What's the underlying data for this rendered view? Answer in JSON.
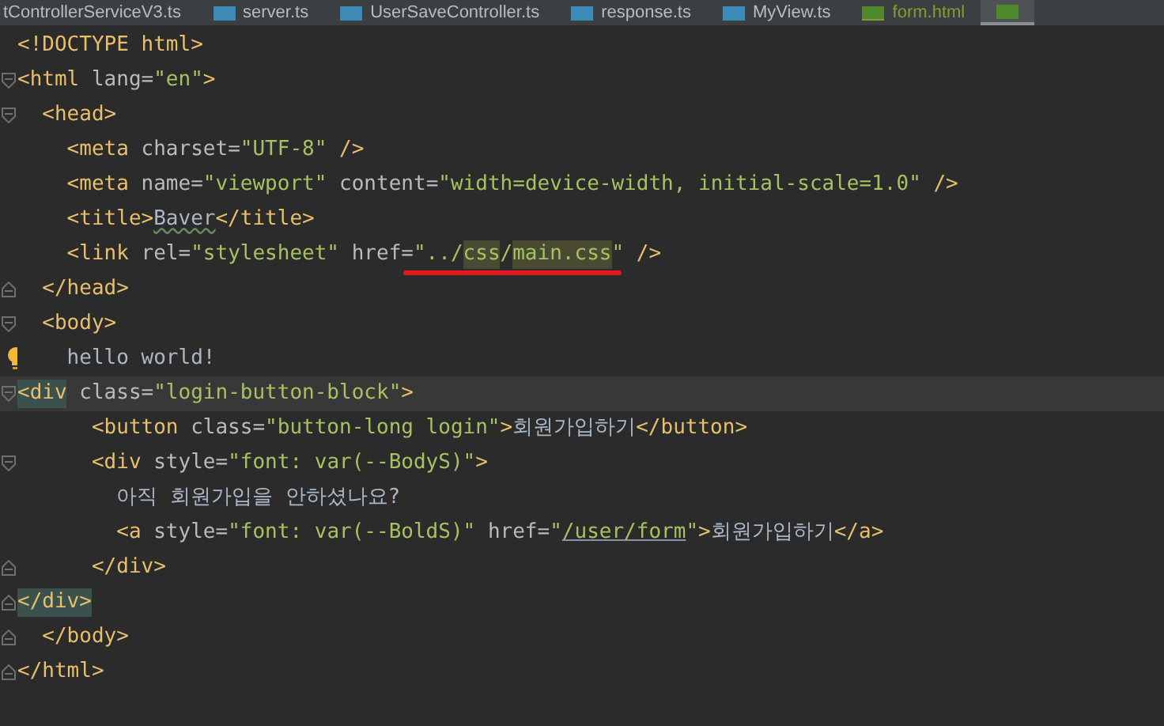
{
  "tabs": [
    {
      "kind": "ts",
      "label": "tControllerServiceV3.ts",
      "selected": false,
      "modified": false
    },
    {
      "kind": "ts",
      "label": "server.ts",
      "selected": false,
      "modified": false
    },
    {
      "kind": "ts",
      "label": "UserSaveController.ts",
      "selected": false,
      "modified": false
    },
    {
      "kind": "ts",
      "label": "response.ts",
      "selected": false,
      "modified": false
    },
    {
      "kind": "ts",
      "label": "MyView.ts",
      "selected": false,
      "modified": false
    },
    {
      "kind": "html",
      "label": "form.html",
      "selected": false,
      "modified": true
    },
    {
      "kind": "html",
      "selected": true,
      "modified": false
    }
  ],
  "editor": {
    "lines": [
      {
        "kind": "plain",
        "current": false,
        "tokens": [
          {
            "kind": "tag",
            "text": "<!DOCTYPE html>"
          }
        ]
      },
      {
        "kind": "fold-start",
        "current": false,
        "tokens": [
          {
            "kind": "tag",
            "text": "<html"
          },
          {
            "kind": "attr",
            "text": " lang"
          },
          {
            "kind": "attr",
            "text": "="
          },
          {
            "kind": "str",
            "text": "\"en\""
          },
          {
            "kind": "tag",
            "text": ">"
          }
        ]
      },
      {
        "kind": "fold-start",
        "current": false,
        "tokens": [
          {
            "kind": "tag",
            "text": "  <head>"
          }
        ]
      },
      {
        "kind": "plain",
        "current": false,
        "tokens": [
          {
            "kind": "tag",
            "text": "    <meta"
          },
          {
            "kind": "attr",
            "text": " charset"
          },
          {
            "kind": "attr",
            "text": "="
          },
          {
            "kind": "str",
            "text": "\"UTF-8\""
          },
          {
            "kind": "tag",
            "text": " />"
          }
        ]
      },
      {
        "kind": "plain",
        "current": false,
        "tokens": [
          {
            "kind": "tag",
            "text": "    <meta"
          },
          {
            "kind": "attr",
            "text": " name"
          },
          {
            "kind": "attr",
            "text": "="
          },
          {
            "kind": "str",
            "text": "\"viewport\""
          },
          {
            "kind": "attr",
            "text": " content"
          },
          {
            "kind": "attr",
            "text": "="
          },
          {
            "kind": "str",
            "text": "\"width=device-width, initial-scale=1.0\""
          },
          {
            "kind": "tag",
            "text": " />"
          }
        ]
      },
      {
        "kind": "plain",
        "current": false,
        "tokens": [
          {
            "kind": "tag",
            "text": "    <title>"
          },
          {
            "kind": "text-typo",
            "text": "Baver"
          },
          {
            "kind": "tag",
            "text": "</title>"
          }
        ]
      },
      {
        "kind": "plain",
        "current": false,
        "tokens": [
          {
            "kind": "tag",
            "text": "    <link"
          },
          {
            "kind": "attr",
            "text": " rel"
          },
          {
            "kind": "attr",
            "text": "="
          },
          {
            "kind": "str",
            "text": "\"stylesheet\""
          },
          {
            "kind": "attr",
            "text": " href"
          },
          {
            "kind": "attr",
            "text": "="
          },
          {
            "kind": "str",
            "text": "\"../",
            "red_underline": true
          },
          {
            "kind": "str-ref",
            "text": "css",
            "red_underline": true
          },
          {
            "kind": "str",
            "text": "/",
            "red_underline": true
          },
          {
            "kind": "str-ref",
            "text": "main.css",
            "red_underline": true
          },
          {
            "kind": "str",
            "text": "\""
          },
          {
            "kind": "tag",
            "text": " />"
          }
        ]
      },
      {
        "kind": "fold-end",
        "current": false,
        "tokens": [
          {
            "kind": "tag",
            "text": "  </head>"
          }
        ]
      },
      {
        "kind": "fold-start",
        "current": false,
        "tokens": [
          {
            "kind": "tag",
            "text": "  <body>"
          }
        ]
      },
      {
        "kind": "bulb",
        "current": false,
        "tokens": [
          {
            "kind": "text",
            "text": "    hello world!"
          }
        ]
      },
      {
        "kind": "fold-start",
        "current": true,
        "tokens": [
          {
            "kind": "tag-match",
            "text": "<div"
          },
          {
            "kind": "attr",
            "text": " class"
          },
          {
            "kind": "attr",
            "text": "="
          },
          {
            "kind": "str",
            "text": "\"login-button-block\""
          },
          {
            "kind": "tag",
            "text": ">"
          }
        ]
      },
      {
        "kind": "plain",
        "current": false,
        "tokens": [
          {
            "kind": "tag",
            "text": "      <button"
          },
          {
            "kind": "attr",
            "text": " class"
          },
          {
            "kind": "attr",
            "text": "="
          },
          {
            "kind": "str",
            "text": "\"button-long login\""
          },
          {
            "kind": "tag",
            "text": ">"
          },
          {
            "kind": "text",
            "text": "회원가입하기"
          },
          {
            "kind": "tag",
            "text": "</button>"
          }
        ]
      },
      {
        "kind": "fold-start",
        "current": false,
        "tokens": [
          {
            "kind": "tag",
            "text": "      <div"
          },
          {
            "kind": "attr",
            "text": " style"
          },
          {
            "kind": "attr",
            "text": "="
          },
          {
            "kind": "str",
            "text": "\"font: var(--BodyS)\""
          },
          {
            "kind": "tag",
            "text": ">"
          }
        ]
      },
      {
        "kind": "plain",
        "current": false,
        "tokens": [
          {
            "kind": "text",
            "text": "        아직 회원가입을 안하셨나요?"
          }
        ]
      },
      {
        "kind": "plain",
        "current": false,
        "tokens": [
          {
            "kind": "tag",
            "text": "        <a"
          },
          {
            "kind": "attr",
            "text": " style"
          },
          {
            "kind": "attr",
            "text": "="
          },
          {
            "kind": "str",
            "text": "\"font: var(--BoldS)\""
          },
          {
            "kind": "attr",
            "text": " href"
          },
          {
            "kind": "attr",
            "text": "="
          },
          {
            "kind": "str",
            "text": "\""
          },
          {
            "kind": "str-link",
            "text": "/user/form"
          },
          {
            "kind": "str",
            "text": "\""
          },
          {
            "kind": "tag",
            "text": ">"
          },
          {
            "kind": "text",
            "text": "회원가입하기"
          },
          {
            "kind": "tag",
            "text": "</a>"
          }
        ]
      },
      {
        "kind": "fold-end",
        "current": false,
        "tokens": [
          {
            "kind": "tag",
            "text": "      </div>"
          }
        ]
      },
      {
        "kind": "fold-end",
        "current": false,
        "tokens": [
          {
            "kind": "tag-match",
            "text": "</div>"
          }
        ]
      },
      {
        "kind": "fold-end",
        "current": false,
        "tokens": [
          {
            "kind": "tag",
            "text": "  </body>"
          }
        ]
      },
      {
        "kind": "fold-end",
        "current": false,
        "tokens": [
          {
            "kind": "tag",
            "text": "</html>"
          }
        ]
      }
    ]
  }
}
